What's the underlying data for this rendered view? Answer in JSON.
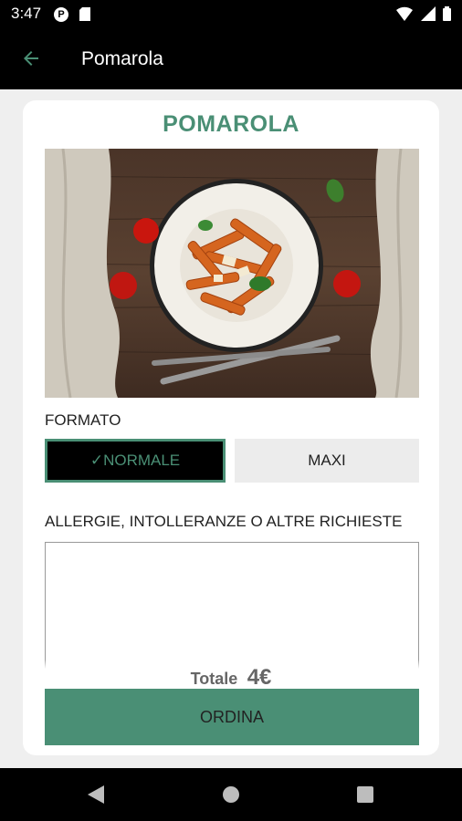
{
  "status_bar": {
    "time": "3:47",
    "icons": [
      "p-icon",
      "sd-card-icon",
      "wifi-icon",
      "signal-icon",
      "battery-icon"
    ]
  },
  "app_bar": {
    "title": "Pomarola",
    "back_icon": "back-arrow-icon"
  },
  "product": {
    "name": "POMAROLA",
    "image": "pasta-dish-photo"
  },
  "format": {
    "label": "FORMATO",
    "options": [
      {
        "label": "✓NORMALE",
        "selected": true
      },
      {
        "label": "MAXI",
        "selected": false
      }
    ]
  },
  "notes": {
    "label": "ALLERGIE, INTOLLERANZE O ALTRE RICHIESTE",
    "value": ""
  },
  "total": {
    "label": "Totale",
    "value": "4€"
  },
  "order_button": {
    "label": "ORDINA"
  },
  "colors": {
    "accent": "#4a8f75",
    "app_bar": "#000000",
    "background": "#efefef"
  },
  "nav_bar": {
    "icons": [
      "nav-back-icon",
      "nav-home-icon",
      "nav-recents-icon"
    ]
  }
}
